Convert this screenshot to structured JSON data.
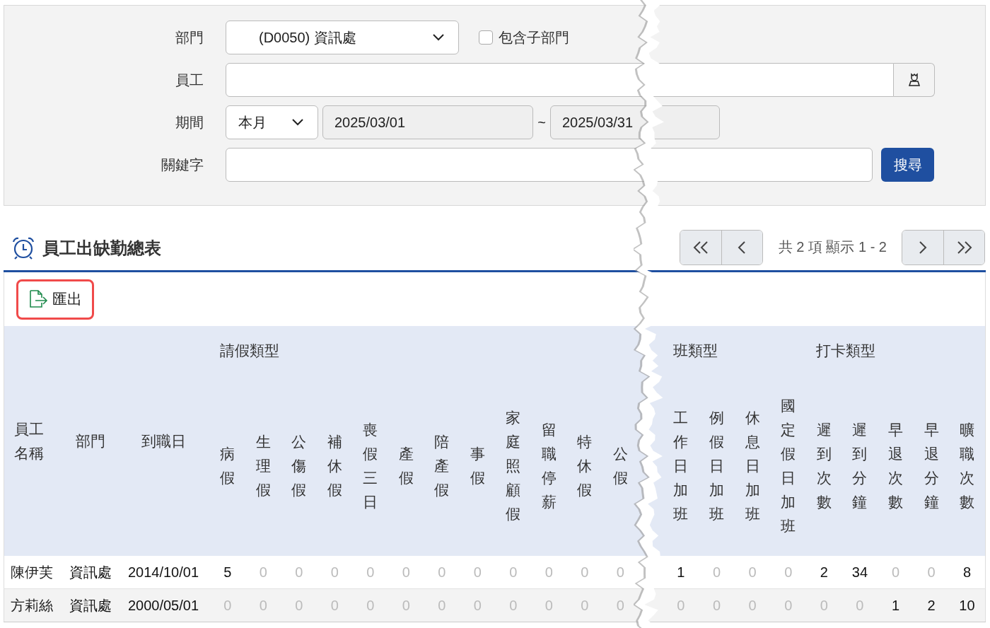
{
  "filters": {
    "department": {
      "label": "部門",
      "value": "(D0050) 資訊處"
    },
    "include_sub": {
      "label": "包含子部門",
      "checked": false
    },
    "employee": {
      "label": "員工"
    },
    "period": {
      "label": "期間",
      "range": "本月",
      "start": "2025/03/01",
      "separator": "~",
      "end": "2025/03/31"
    },
    "keyword": {
      "label": "關鍵字"
    },
    "search_button": "搜尋"
  },
  "report": {
    "title": "員工出缺勤總表",
    "pager": {
      "info": "共 2 項 顯示 1 - 2"
    },
    "export_button": {
      "label": "匯出",
      "highlighted": true
    }
  },
  "table": {
    "columns": [
      {
        "label": "員工名稱"
      },
      {
        "label": "部門"
      },
      {
        "label": "到職日"
      }
    ],
    "groups": [
      {
        "label": "請假類型",
        "columns": [
          "病假",
          "生理假",
          "公傷假",
          "補休假",
          "喪假三日",
          "產假",
          "陪產假",
          "事假",
          "家庭照顧假",
          "留職停薪",
          "特休假",
          "公假"
        ]
      },
      {
        "label": "班類型",
        "columns": [
          "工作日加班",
          "例假日加班",
          "休息日加班",
          "國定假日加班"
        ]
      },
      {
        "label": "打卡類型",
        "columns": [
          "遲到次數",
          "遲到分鐘",
          "早退次數",
          "早退分鐘",
          "曠職次數"
        ]
      }
    ],
    "rows": [
      {
        "name": "陳伊芙",
        "department": "資訊處",
        "hire_date": "2014/10/01",
        "cells": [
          {
            "v": "5",
            "dim": false
          },
          {
            "v": "0",
            "dim": true
          },
          {
            "v": "0",
            "dim": true
          },
          {
            "v": "0",
            "dim": true
          },
          {
            "v": "0",
            "dim": true
          },
          {
            "v": "0",
            "dim": true
          },
          {
            "v": "0",
            "dim": true
          },
          {
            "v": "0",
            "dim": true
          },
          {
            "v": "0",
            "dim": true
          },
          {
            "v": "0",
            "dim": true
          },
          {
            "v": "0",
            "dim": true
          },
          {
            "v": "0",
            "dim": true
          },
          {
            "v": "1",
            "dim": false
          },
          {
            "v": "0",
            "dim": true
          },
          {
            "v": "0",
            "dim": true
          },
          {
            "v": "0",
            "dim": true
          },
          {
            "v": "2",
            "dim": false
          },
          {
            "v": "34",
            "dim": false
          },
          {
            "v": "0",
            "dim": true
          },
          {
            "v": "0",
            "dim": true
          },
          {
            "v": "8",
            "dim": false
          }
        ]
      },
      {
        "name": "方莉絲",
        "department": "資訊處",
        "hire_date": "2000/05/01",
        "cells": [
          {
            "v": "0",
            "dim": true
          },
          {
            "v": "0",
            "dim": true
          },
          {
            "v": "0",
            "dim": true
          },
          {
            "v": "0",
            "dim": true
          },
          {
            "v": "0",
            "dim": true
          },
          {
            "v": "0",
            "dim": true
          },
          {
            "v": "0",
            "dim": true
          },
          {
            "v": "0",
            "dim": true
          },
          {
            "v": "0",
            "dim": true
          },
          {
            "v": "0",
            "dim": true
          },
          {
            "v": "0",
            "dim": true
          },
          {
            "v": "0",
            "dim": true
          },
          {
            "v": "0",
            "dim": true
          },
          {
            "v": "0",
            "dim": true
          },
          {
            "v": "0",
            "dim": true
          },
          {
            "v": "0",
            "dim": true
          },
          {
            "v": "0",
            "dim": true
          },
          {
            "v": "0",
            "dim": true
          },
          {
            "v": "1",
            "dim": false
          },
          {
            "v": "2",
            "dim": false
          },
          {
            "v": "10",
            "dim": false
          }
        ]
      }
    ]
  }
}
